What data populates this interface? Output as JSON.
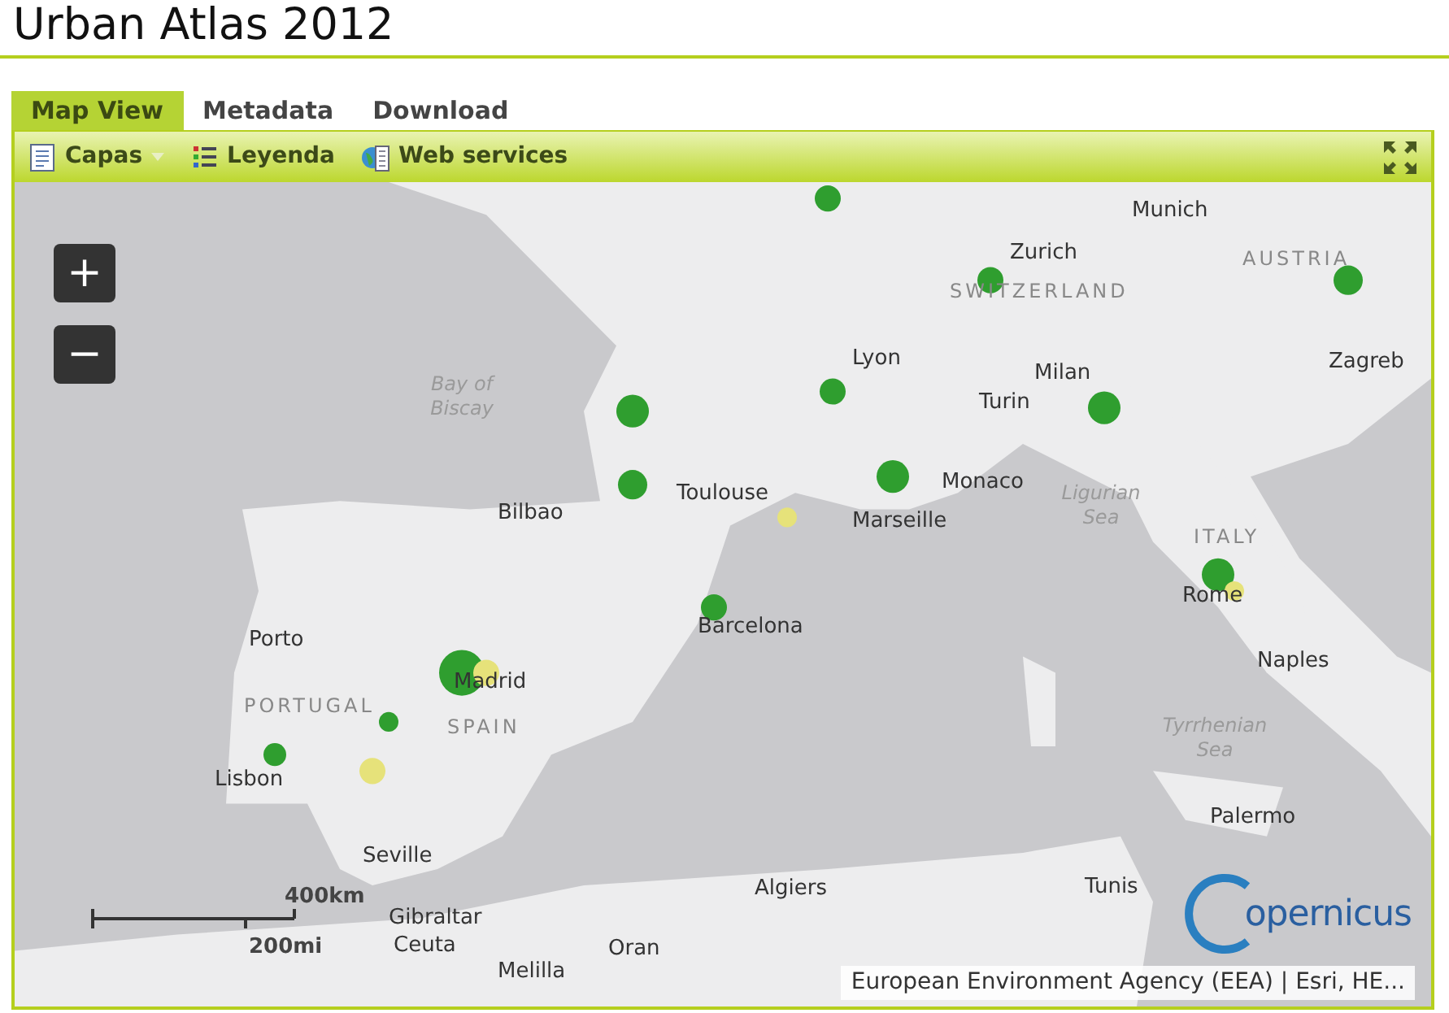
{
  "page_title": "Urban Atlas 2012",
  "tabs": [
    {
      "label": "Map View",
      "selected": true
    },
    {
      "label": "Metadata",
      "selected": false
    },
    {
      "label": "Download",
      "selected": false
    }
  ],
  "toolbar": [
    {
      "label": "Capas",
      "kind": "layers",
      "dropdown": true
    },
    {
      "label": "Leyenda",
      "kind": "legend",
      "dropdown": false
    },
    {
      "label": "Web services",
      "kind": "globe",
      "dropdown": false
    }
  ],
  "map": {
    "zoom_in": "+",
    "zoom_out": "−",
    "labels": [
      {
        "text": "Munich",
        "kind": "city"
      },
      {
        "text": "Zurich",
        "kind": "city"
      },
      {
        "text": "AUSTRIA",
        "kind": "country"
      },
      {
        "text": "SWITZERLAND",
        "kind": "country"
      },
      {
        "text": "Zagreb",
        "kind": "city"
      },
      {
        "text": "Bay of Biscay",
        "kind": "sea"
      },
      {
        "text": "Lyon",
        "kind": "city"
      },
      {
        "text": "Milan",
        "kind": "city"
      },
      {
        "text": "Turin",
        "kind": "city"
      },
      {
        "text": "Toulouse",
        "kind": "city"
      },
      {
        "text": "Monaco",
        "kind": "city"
      },
      {
        "text": "Bilbao",
        "kind": "city"
      },
      {
        "text": "Marseille",
        "kind": "city"
      },
      {
        "text": "Ligurian Sea",
        "kind": "sea"
      },
      {
        "text": "ITALY",
        "kind": "country"
      },
      {
        "text": "Barcelona",
        "kind": "city"
      },
      {
        "text": "Rome",
        "kind": "city"
      },
      {
        "text": "Porto",
        "kind": "city"
      },
      {
        "text": "PORTUGAL",
        "kind": "country"
      },
      {
        "text": "Madrid",
        "kind": "city"
      },
      {
        "text": "SPAIN",
        "kind": "country"
      },
      {
        "text": "Naples",
        "kind": "city"
      },
      {
        "text": "Tyrrhenian Sea",
        "kind": "sea"
      },
      {
        "text": "Lisbon",
        "kind": "city"
      },
      {
        "text": "Palermo",
        "kind": "city"
      },
      {
        "text": "Seville",
        "kind": "city"
      },
      {
        "text": "Algiers",
        "kind": "city"
      },
      {
        "text": "Tunis",
        "kind": "city"
      },
      {
        "text": "Gibraltar",
        "kind": "city"
      },
      {
        "text": "Ceuta",
        "kind": "city"
      },
      {
        "text": "Oran",
        "kind": "city"
      },
      {
        "text": "Melilla",
        "kind": "city"
      }
    ],
    "scale_km": "400km",
    "scale_mi": "200mi",
    "logo_text": "opernicus",
    "attribution": "European Environment Agency (EEA) | Esri, HE..."
  }
}
